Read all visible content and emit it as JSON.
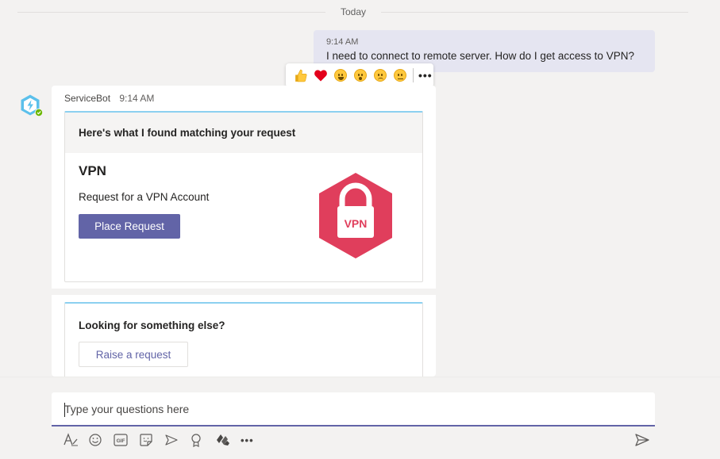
{
  "divider": {
    "label": "Today"
  },
  "my_message": {
    "time": "9:14 AM",
    "text": "I need to connect to remote server. How do I get access to VPN?"
  },
  "reactions": {
    "items": [
      "like-icon",
      "heart-icon",
      "laugh-icon",
      "surprised-icon",
      "sad-icon",
      "angry-icon"
    ],
    "more": "•••"
  },
  "bot_message": {
    "sender": "ServiceBot",
    "time": "9:14 AM",
    "card1": {
      "header": "Here's what I found matching your request",
      "title": "VPN",
      "description": "Request for a VPN Account",
      "button": "Place Request",
      "badge_text": "VPN",
      "badge_color": "#e03e5c"
    },
    "card2": {
      "title": "Looking for something else?",
      "button": "Raise a request"
    }
  },
  "compose": {
    "placeholder": "Type your questions here",
    "tools": [
      "format-icon",
      "emoji-icon",
      "gif-icon",
      "sticker-icon",
      "meet-icon",
      "praise-icon",
      "app-icon",
      "more-options-icon"
    ],
    "more_label": "•••"
  },
  "colors": {
    "accent": "#6264a7",
    "card_border_top": "#8cd0f0",
    "bot_avatar": "#5bc0eb"
  }
}
